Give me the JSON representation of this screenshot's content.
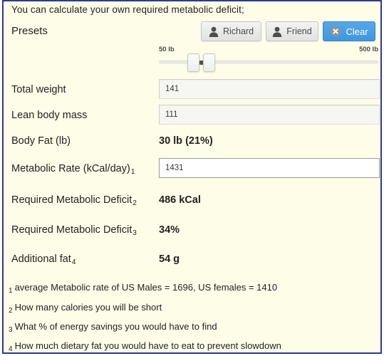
{
  "panel": {
    "intro_text": "You can calculate your own required metabolic deficit;",
    "accent_border": "#2a3b8f",
    "background": "#fdfde8"
  },
  "presets": {
    "label": "Presets",
    "buttons": [
      {
        "label": "Richard",
        "icon": "person-icon",
        "style": "default"
      },
      {
        "label": "Friend",
        "icon": "person-icon",
        "style": "default"
      },
      {
        "label": "Clear",
        "icon": "clear-circle-x-icon",
        "style": "primary",
        "color": "#3f97e0"
      }
    ]
  },
  "weight_slider": {
    "min_label": "50 lb",
    "max_label": "500 lb",
    "min_value": 50,
    "max_value": 500,
    "handles": [
      111,
      141
    ]
  },
  "fields": {
    "total_weight": {
      "label": "Total weight",
      "value": "141",
      "focused": false
    },
    "lean_body_mass": {
      "label": "Lean body mass",
      "value": "111",
      "focused": false
    },
    "metabolic_rate": {
      "label": "Metabolic Rate (kCal/day)",
      "note": "1",
      "value": "1431",
      "focused": true
    }
  },
  "results": {
    "body_fat": {
      "label": "Body Fat (lb)",
      "value": "30 lb (21%)"
    },
    "required_deficit_kcal": {
      "label": "Required Metabolic Deficit",
      "note": "2",
      "value": "486 kCal"
    },
    "required_deficit_pct": {
      "label": "Required Metabolic Deficit",
      "note": "3",
      "value": "34%"
    },
    "additional_fat": {
      "label": "Additional fat",
      "note": "4",
      "value": "54 g"
    }
  },
  "footnotes": [
    {
      "num": "1",
      "text": "average Metabolic rate of US Males = 1696, US females = 1410"
    },
    {
      "num": "2",
      "text": "How many calories you will be short"
    },
    {
      "num": "3",
      "text": "What % of energy savings you would have to find"
    },
    {
      "num": "4",
      "text": "How much dietary fat you would have to eat to prevent slowdown"
    }
  ]
}
